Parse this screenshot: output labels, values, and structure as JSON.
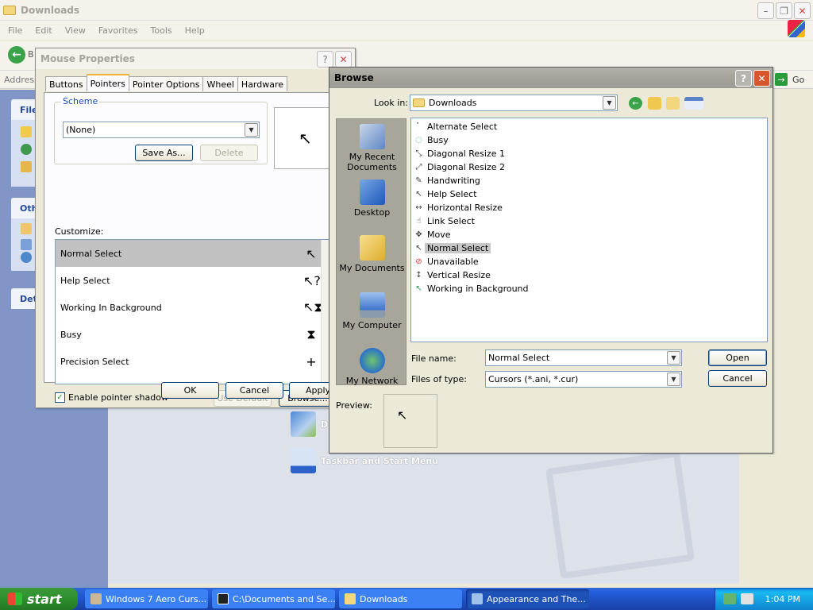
{
  "explorer": {
    "title": "Downloads",
    "menu": [
      "File",
      "Edit",
      "View",
      "Favorites",
      "Tools",
      "Help"
    ],
    "back_label": "B",
    "address_label": "Address",
    "go_label": "Go",
    "taskpane": {
      "file_header": "File",
      "other_header": "Oth",
      "details_header": "Det"
    },
    "panel_links": [
      "D",
      "Taskbar and Start Menu"
    ]
  },
  "mouse_properties": {
    "title": "Mouse Properties",
    "tabs": [
      "Buttons",
      "Pointers",
      "Pointer Options",
      "Wheel",
      "Hardware"
    ],
    "active_tab": "Pointers",
    "scheme_label": "Scheme",
    "scheme_value": "(None)",
    "save_as": "Save As...",
    "delete": "Delete",
    "customize_label": "Customize:",
    "cursors": [
      {
        "name": "Normal Select",
        "glyph": "↖"
      },
      {
        "name": "Help Select",
        "glyph": "↖?"
      },
      {
        "name": "Working In Background",
        "glyph": "↖⧗"
      },
      {
        "name": "Busy",
        "glyph": "⧗"
      },
      {
        "name": "Precision Select",
        "glyph": "+"
      }
    ],
    "selected_cursor": "Normal Select",
    "shadow_label": "Enable pointer shadow",
    "shadow_checked": true,
    "use_default": "Use Default",
    "browse": "Browse...",
    "ok": "OK",
    "cancel": "Cancel",
    "apply": "Apply"
  },
  "browse": {
    "title": "Browse",
    "look_in_label": "Look in:",
    "look_in_value": "Downloads",
    "places": [
      "My Recent Documents",
      "Desktop",
      "My Documents",
      "My Computer",
      "My Network"
    ],
    "files": [
      "Alternate Select",
      "Busy",
      "Diagonal Resize 1",
      "Diagonal Resize 2",
      "Handwriting",
      "Help Select",
      "Horizontal Resize",
      "Link Select",
      "Move",
      "Normal Select",
      "Unavailable",
      "Vertical Resize",
      "Working in Background"
    ],
    "selected_file": "Normal Select",
    "file_name_label": "File name:",
    "file_name_value": "Normal Select",
    "files_of_type_label": "Files of type:",
    "files_of_type_value": "Cursors (*.ani, *.cur)",
    "open": "Open",
    "cancel": "Cancel",
    "preview_label": "Preview:"
  },
  "taskbar": {
    "start": "start",
    "tasks": [
      "Windows 7 Aero Curs...",
      "C:\\Documents and Se...",
      "Downloads",
      "Appearance and The..."
    ],
    "active_task": "Appearance and The...",
    "clock": "1:04 PM"
  }
}
